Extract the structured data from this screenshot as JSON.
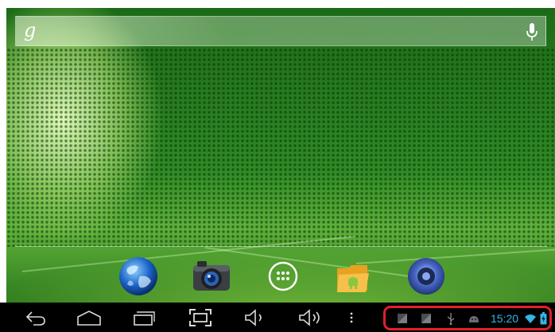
{
  "search": {
    "logo": "g"
  },
  "status_bar": {
    "time": "15:20"
  },
  "colors": {
    "clock": "#33b5e5",
    "highlight_border": "#e0202a"
  },
  "dock": {
    "items": [
      {
        "icon": "browser-globe-icon"
      },
      {
        "icon": "camera-icon"
      },
      {
        "icon": "app-drawer-icon"
      },
      {
        "icon": "file-manager-folder-icon"
      },
      {
        "icon": "music-speaker-icon"
      }
    ]
  },
  "nav": {
    "buttons": [
      {
        "icon": "back-icon"
      },
      {
        "icon": "home-icon"
      },
      {
        "icon": "recent-apps-icon"
      },
      {
        "icon": "screenshot-icon"
      },
      {
        "icon": "volume-down-icon"
      },
      {
        "icon": "volume-up-icon"
      },
      {
        "icon": "menu-icon"
      }
    ]
  },
  "notifications": [
    {
      "icon": "notification-image-icon"
    },
    {
      "icon": "notification-image-icon"
    },
    {
      "icon": "usb-icon"
    },
    {
      "icon": "android-debug-icon"
    }
  ],
  "status_icons": [
    {
      "icon": "wifi-icon"
    },
    {
      "icon": "battery-charging-icon"
    }
  ]
}
